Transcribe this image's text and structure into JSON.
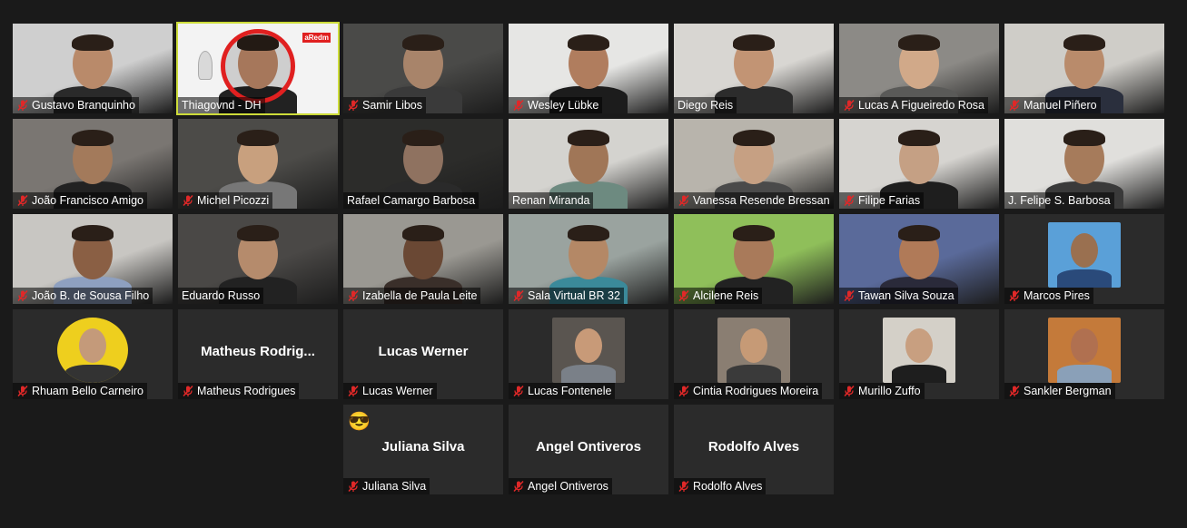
{
  "participants": [
    {
      "name": "Gustavo Branquinho",
      "muted": true,
      "video": true,
      "bg": "#cfcfcf",
      "skin": "#b98a6a",
      "shirt": "#2a2a2a"
    },
    {
      "name": "Thiagovnd - DH",
      "muted": false,
      "video": true,
      "bg": "#f0f0f0",
      "skin": "#c48c6c",
      "shirt": "#222",
      "active": true,
      "overlay_text": "aRedm"
    },
    {
      "name": "Samir Libos",
      "muted": true,
      "video": true,
      "bg": "#4a4a48",
      "skin": "#a8846a",
      "shirt": "#3a3a3a"
    },
    {
      "name": "Wesley Lübke",
      "muted": true,
      "video": true,
      "bg": "#e6e6e4",
      "skin": "#b07d5e",
      "shirt": "#1c1c1c"
    },
    {
      "name": "Diego Reis",
      "muted": false,
      "video": true,
      "bg": "#d8d6d2",
      "skin": "#c29474",
      "shirt": "#2c2c2c"
    },
    {
      "name": "Lucas A Figueiredo Rosa",
      "muted": true,
      "video": true,
      "bg": "#8c8a86",
      "skin": "#d1a989",
      "shirt": "#5a5a58"
    },
    {
      "name": "Manuel Piñero",
      "muted": true,
      "video": true,
      "bg": "#cfcdc8",
      "skin": "#b98b6b",
      "shirt": "#2a2f3d"
    },
    {
      "name": "João Francisco Amigo",
      "muted": true,
      "video": true,
      "bg": "#7a7672",
      "skin": "#a37a5b",
      "shirt": "#222"
    },
    {
      "name": "Michel Picozzi",
      "muted": true,
      "video": true,
      "bg": "#4c4b48",
      "skin": "#c8a07e",
      "shirt": "#777"
    },
    {
      "name": "Rafael Camargo Barbosa",
      "muted": false,
      "video": true,
      "bg": "#2c2c2a",
      "skin": "#8f7260",
      "shirt": "#2a2a2a"
    },
    {
      "name": "Renan Miranda",
      "muted": false,
      "video": true,
      "bg": "#d4d3cf",
      "skin": "#a07657",
      "shirt": "#6d8a80"
    },
    {
      "name": "Vanessa Resende Bressan",
      "muted": true,
      "video": true,
      "bg": "#b8b4ac",
      "skin": "#c6a083",
      "shirt": "#4a4a4a"
    },
    {
      "name": "Filipe Farias",
      "muted": true,
      "video": true,
      "bg": "#d6d4d0",
      "skin": "#c5a084",
      "shirt": "#1e1e1e"
    },
    {
      "name": "J. Felipe S. Barbosa",
      "muted": false,
      "video": true,
      "bg": "#e0dfdc",
      "skin": "#a67b5b",
      "shirt": "#3a3a3a"
    },
    {
      "name": "João B. de Sousa Filho",
      "muted": true,
      "video": true,
      "bg": "#c8c6c2",
      "skin": "#8a5f44",
      "shirt": "#8ea0c0"
    },
    {
      "name": "Eduardo Russo",
      "muted": false,
      "video": true,
      "bg": "#4a4846",
      "skin": "#b58b6c",
      "shirt": "#222"
    },
    {
      "name": "Izabella de Paula Leite",
      "muted": true,
      "video": true,
      "bg": "#9a9892",
      "skin": "#6a4834",
      "shirt": "#3a2f2a"
    },
    {
      "name": "Sala Virtual BR 32",
      "muted": true,
      "video": true,
      "bg": "#9aa39f",
      "skin": "#b48866",
      "shirt": "#3b8a9a"
    },
    {
      "name": "Alcilene Reis",
      "muted": true,
      "video": true,
      "bg": "#8fbf5a",
      "skin": "#a97a5a",
      "shirt": "#222"
    },
    {
      "name": "Tawan Silva Souza",
      "muted": true,
      "video": true,
      "bg": "#5a6a9a",
      "skin": "#b07a58",
      "shirt": "#2a2a3a"
    },
    {
      "name": "Marcos Pires",
      "muted": true,
      "video": false,
      "photo": true,
      "photo_bg": "#5aa0d8",
      "skin": "#9a7050",
      "shirt": "#2a4a7a"
    },
    {
      "name": "Rhuam Bello Carneiro",
      "muted": true,
      "video": false,
      "photo": true,
      "photo_bg": "#eecf1e",
      "skin": "#c49a7a",
      "shirt": "#333",
      "round": true
    },
    {
      "name": "Matheus Rodrigues",
      "muted": true,
      "video": false,
      "display": "Matheus  Rodrig..."
    },
    {
      "name": "Lucas Werner",
      "muted": true,
      "video": false,
      "display": "Lucas Werner"
    },
    {
      "name": "Lucas Fontenele",
      "muted": true,
      "video": false,
      "photo": true,
      "photo_bg": "#5a5550",
      "skin": "#c89a78",
      "shirt": "#7a8088"
    },
    {
      "name": "Cintia Rodrigues Moreira",
      "muted": true,
      "video": false,
      "photo": true,
      "photo_bg": "#8a7e72",
      "skin": "#c69a76",
      "shirt": "#3a3a3a"
    },
    {
      "name": "Murillo Zuffo",
      "muted": true,
      "video": false,
      "photo": true,
      "photo_bg": "#d4d0c8",
      "skin": "#c89f80",
      "shirt": "#1e1e1e"
    },
    {
      "name": "Sankler Bergman",
      "muted": true,
      "video": false,
      "photo": true,
      "photo_bg": "#c47a3a",
      "skin": "#b07050",
      "shirt": "#8aa0b8"
    },
    {
      "name": "Juliana Silva",
      "muted": true,
      "video": false,
      "display": "Juliana Silva",
      "emoji": "😎"
    },
    {
      "name": "Angel Ontiveros",
      "muted": true,
      "video": false,
      "display": "Angel Ontiveros"
    },
    {
      "name": "Rodolfo Alves",
      "muted": true,
      "video": false,
      "display": "Rodolfo Alves"
    }
  ],
  "colors": {
    "active_border": "#cddc39",
    "muted_icon": "#e02828",
    "tile_bg": "#2b2b2b",
    "page_bg": "#1a1a1a"
  }
}
